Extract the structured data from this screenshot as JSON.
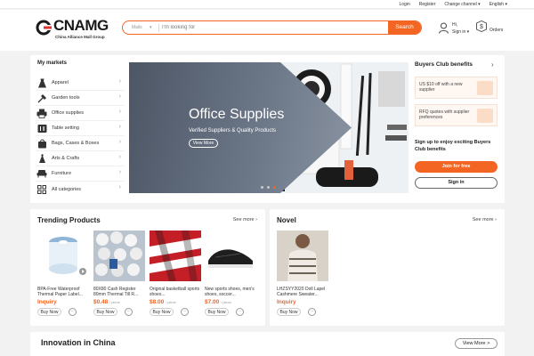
{
  "topbar": {
    "links": [
      "Login",
      "Register",
      "Change channel ▾",
      "English ▾"
    ]
  },
  "header": {
    "logo_text": "CNAMG",
    "logo_sub": "China Alliance Mall Group",
    "search": {
      "category": "Mails",
      "placeholder": "I'm looking for",
      "button": "Search"
    },
    "account": {
      "hi": "Hi,",
      "sign_in": "Sign in ▾"
    },
    "orders": "Orders"
  },
  "markets": {
    "title": "My markets",
    "items": [
      {
        "label": "Apparel",
        "icon": "dress-icon"
      },
      {
        "label": "Garden tools",
        "icon": "garden-tools-icon"
      },
      {
        "label": "Office supplies",
        "icon": "printer-icon"
      },
      {
        "label": "Table setting",
        "icon": "cutlery-icon"
      },
      {
        "label": "Bags, Cases & Boxes",
        "icon": "bag-icon"
      },
      {
        "label": "Arts & Crafts",
        "icon": "palette-icon"
      },
      {
        "label": "Furniture",
        "icon": "sofa-icon"
      },
      {
        "label": "All categories",
        "icon": "grid-icon"
      }
    ]
  },
  "banner": {
    "title": "Office Supplies",
    "subtitle": "Verified Suppliers & Quality Products",
    "button": "View More",
    "slides": 3,
    "active_slide": 3
  },
  "buyers_club": {
    "title": "Buyers Club benefits",
    "benefits": [
      "US $10 off with a new supplier",
      "RFQ quotes with supplier preferences"
    ],
    "text": "Sign up to enjoy exciting Buyers Club benefits",
    "join": "Join for free",
    "sign_in": "Sign in"
  },
  "trending": {
    "title": "Trending Products",
    "see_more": "See more",
    "products": [
      {
        "name": "BPA-Free Waterproof Thermal Paper Label...",
        "price": "Inquiry",
        "unit": "",
        "buy": "Buy Now"
      },
      {
        "name": "80X80 Cash Register 80mm Thermal Till R...",
        "price": "$0.48",
        "unit": "/ piece",
        "buy": "Buy Now"
      },
      {
        "name": "Original basketball sports shoes...",
        "price": "$8.00",
        "unit": "/ piece",
        "buy": "Buy Now"
      },
      {
        "name": "New sports shoes, men's shoes, soccer...",
        "price": "$7.00",
        "unit": "/ piece",
        "buy": "Buy Now"
      }
    ]
  },
  "novel": {
    "title": "Novel",
    "see_more": "See more",
    "products": [
      {
        "name": "LHZSYY2020 Doll Lapel Cashmere Sweater...",
        "price": "Inquiry",
        "unit": "",
        "buy": "Buy Now"
      }
    ]
  },
  "innovation": {
    "title": "Innovation in China",
    "view_more": "View More >"
  },
  "colors": {
    "accent": "#f26522",
    "background": "#f2f2f2"
  }
}
